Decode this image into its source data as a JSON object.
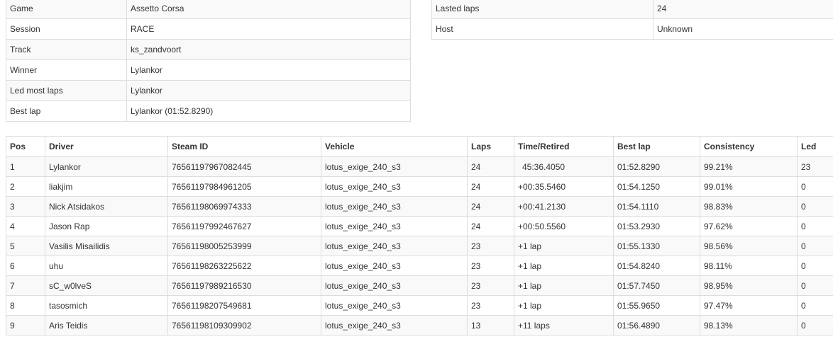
{
  "session_info_left": [
    {
      "label": "Game",
      "value": "Assetto Corsa"
    },
    {
      "label": "Session",
      "value": "RACE"
    },
    {
      "label": "Track",
      "value": "ks_zandvoort"
    },
    {
      "label": "Winner",
      "value": "Lylankor"
    },
    {
      "label": "Led most laps",
      "value": "Lylankor"
    },
    {
      "label": "Best lap",
      "value": "Lylankor (01:52.8290)"
    }
  ],
  "session_info_right": [
    {
      "label": "Lasted laps",
      "value": "24"
    },
    {
      "label": "Host",
      "value": "Unknown"
    }
  ],
  "results": {
    "headers": [
      "Pos",
      "Driver",
      "Steam ID",
      "Vehicle",
      "Laps",
      "Time/Retired",
      "Best lap",
      "Consistency",
      "Led"
    ],
    "rows": [
      [
        "1",
        "Lylankor",
        "76561197967082445",
        "lotus_exige_240_s3",
        "24",
        "45:36.4050",
        "01:52.8290",
        "99.21%",
        "23"
      ],
      [
        "2",
        "liakjim",
        "76561197984961205",
        "lotus_exige_240_s3",
        "24",
        "+00:35.5460",
        "01:54.1250",
        "99.01%",
        "0"
      ],
      [
        "3",
        "Nick Atsidakos",
        "76561198069974333",
        "lotus_exige_240_s3",
        "24",
        "+00:41.2130",
        "01:54.1110",
        "98.83%",
        "0"
      ],
      [
        "4",
        "Jason Rap",
        "76561197992467627",
        "lotus_exige_240_s3",
        "24",
        "+00:50.5560",
        "01:53.2930",
        "97.62%",
        "0"
      ],
      [
        "5",
        "Vasilis Misailidis",
        "76561198005253999",
        "lotus_exige_240_s3",
        "23",
        "+1 lap",
        "01:55.1330",
        "98.56%",
        "0"
      ],
      [
        "6",
        "uhu",
        "76561198263225622",
        "lotus_exige_240_s3",
        "23",
        "+1 lap",
        "01:54.8240",
        "98.11%",
        "0"
      ],
      [
        "7",
        "sC_w0lveS",
        "76561197989216530",
        "lotus_exige_240_s3",
        "23",
        "+1 lap",
        "01:57.7450",
        "98.95%",
        "0"
      ],
      [
        "8",
        "tasosmich",
        "76561198207549681",
        "lotus_exige_240_s3",
        "23",
        "+1 lap",
        "01:55.9650",
        "97.47%",
        "0"
      ],
      [
        "9",
        "Aris Teidis",
        "76561198109309902",
        "lotus_exige_240_s3",
        "13",
        "+11 laps",
        "01:56.4890",
        "98.13%",
        "0"
      ]
    ]
  }
}
